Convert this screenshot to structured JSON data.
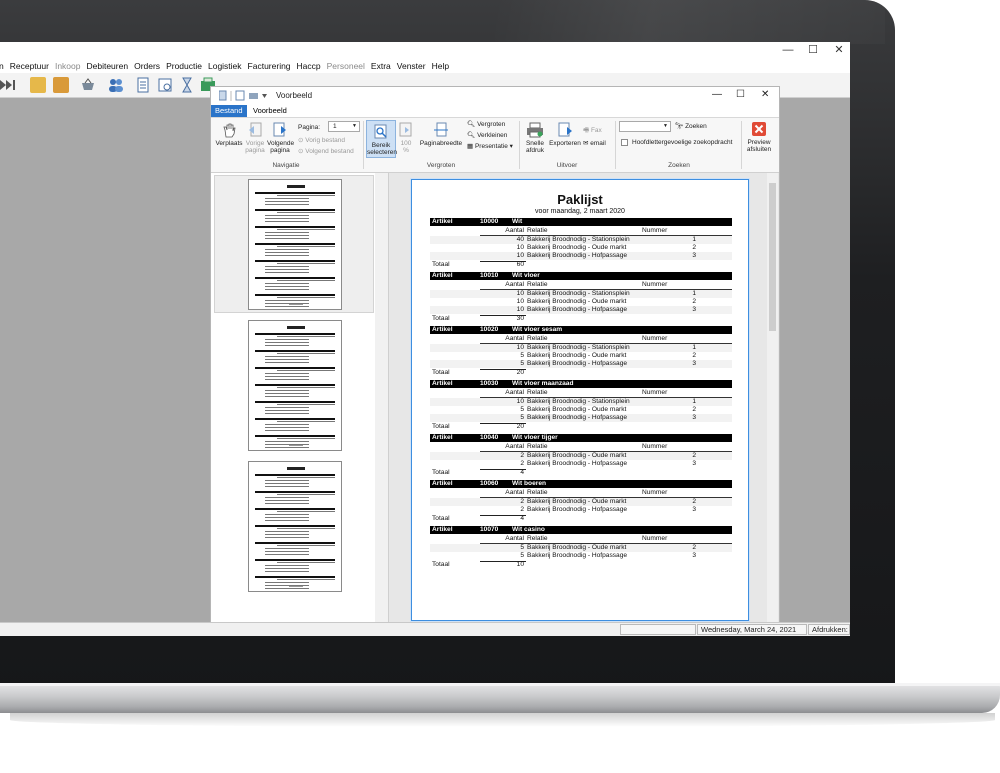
{
  "menu": {
    "items": [
      {
        "label": "n",
        "disabled": false
      },
      {
        "label": "Receptuur",
        "disabled": false
      },
      {
        "label": "Inkoop",
        "disabled": true
      },
      {
        "label": "Debiteuren",
        "disabled": false
      },
      {
        "label": "Orders",
        "disabled": false
      },
      {
        "label": "Productie",
        "disabled": false
      },
      {
        "label": "Logistiek",
        "disabled": false
      },
      {
        "label": "Facturering",
        "disabled": false
      },
      {
        "label": "Haccp",
        "disabled": false
      },
      {
        "label": "Personeel",
        "disabled": true
      },
      {
        "label": "Extra",
        "disabled": false
      },
      {
        "label": "Venster",
        "disabled": false
      },
      {
        "label": "Help",
        "disabled": false
      }
    ]
  },
  "window": {
    "minimize": "—",
    "maximize": "☐",
    "close": "✕"
  },
  "status": {
    "date": "Wednesday, March 24, 2021",
    "print": "Afdrukken: G"
  },
  "preview": {
    "title": "Voorbeeld",
    "tabs": [
      {
        "label": "Bestand",
        "active": true
      },
      {
        "label": "Voorbeeld",
        "active": false
      }
    ],
    "ribbon": {
      "verplaats": "Verplaats",
      "vorige": "Vorige pagina",
      "volgende": "Volgende pagina",
      "pagina_label": "Pagina:",
      "pagina_value": "1",
      "vorig_bestand": "Vorig bestand",
      "volgend_bestand": "Volgend bestand",
      "bereik": "Bereik selecteren",
      "zoom100": "100 %",
      "paginabreedte": "Paginabreedte",
      "vergroten": "Vergroten",
      "verkleinen": "Verkleinen",
      "presentatie": "Presentatie",
      "snelle": "Snelle afdruk",
      "exporteren": "Exporteren",
      "fax": "Fax",
      "email": "email",
      "zoeken": "Zoeken",
      "hoofdletter": "Hoofdlettergevoelige zoekopdracht",
      "preview_afsluiten": "Preview afsluiten",
      "groups": {
        "navigatie": "Navigatie",
        "vergroten": "Vergroten",
        "uitvoer": "Uitvoer",
        "zoeken": "Zoeken"
      }
    }
  },
  "report": {
    "title": "Paklijst",
    "subtitle": "voor maandag, 2 maart 2020",
    "labels": {
      "artikel": "Artikel",
      "aantal": "Aantal",
      "relatie": "Relatie",
      "nummer": "Nummer",
      "totaal": "Totaal"
    },
    "sections": [
      {
        "code": "10000",
        "name": "Wit",
        "rows": [
          {
            "qty": "40",
            "relation": "Bakkerij Broodnodig - Stationsplein",
            "nr": "1"
          },
          {
            "qty": "10",
            "relation": "Bakkerij Broodnodig - Oude markt",
            "nr": "2"
          },
          {
            "qty": "10",
            "relation": "Bakkerij Broodnodig - Hofpassage",
            "nr": "3"
          }
        ],
        "total": "60"
      },
      {
        "code": "10010",
        "name": "Wit vloer",
        "rows": [
          {
            "qty": "10",
            "relation": "Bakkerij Broodnodig - Stationsplein",
            "nr": "1"
          },
          {
            "qty": "10",
            "relation": "Bakkerij Broodnodig - Oude markt",
            "nr": "2"
          },
          {
            "qty": "10",
            "relation": "Bakkerij Broodnodig - Hofpassage",
            "nr": "3"
          }
        ],
        "total": "30"
      },
      {
        "code": "10020",
        "name": "Wit vloer sesam",
        "rows": [
          {
            "qty": "10",
            "relation": "Bakkerij Broodnodig - Stationsplein",
            "nr": "1"
          },
          {
            "qty": "5",
            "relation": "Bakkerij Broodnodig - Oude markt",
            "nr": "2"
          },
          {
            "qty": "5",
            "relation": "Bakkerij Broodnodig - Hofpassage",
            "nr": "3"
          }
        ],
        "total": "20"
      },
      {
        "code": "10030",
        "name": "Wit vloer maanzaad",
        "rows": [
          {
            "qty": "10",
            "relation": "Bakkerij Broodnodig - Stationsplein",
            "nr": "1"
          },
          {
            "qty": "5",
            "relation": "Bakkerij Broodnodig - Oude markt",
            "nr": "2"
          },
          {
            "qty": "5",
            "relation": "Bakkerij Broodnodig - Hofpassage",
            "nr": "3"
          }
        ],
        "total": "20"
      },
      {
        "code": "10040",
        "name": "Wit vloer tijger",
        "rows": [
          {
            "qty": "2",
            "relation": "Bakkerij Broodnodig - Oude markt",
            "nr": "2"
          },
          {
            "qty": "2",
            "relation": "Bakkerij Broodnodig - Hofpassage",
            "nr": "3"
          }
        ],
        "total": "4"
      },
      {
        "code": "10060",
        "name": "Wit boeren",
        "rows": [
          {
            "qty": "2",
            "relation": "Bakkerij Broodnodig - Oude markt",
            "nr": "2"
          },
          {
            "qty": "2",
            "relation": "Bakkerij Broodnodig - Hofpassage",
            "nr": "3"
          }
        ],
        "total": "4"
      },
      {
        "code": "10070",
        "name": "Wit casino",
        "rows": [
          {
            "qty": "5",
            "relation": "Bakkerij Broodnodig - Oude markt",
            "nr": "2"
          },
          {
            "qty": "5",
            "relation": "Bakkerij Broodnodig - Hofpassage",
            "nr": "3"
          }
        ],
        "total": "10"
      }
    ]
  }
}
